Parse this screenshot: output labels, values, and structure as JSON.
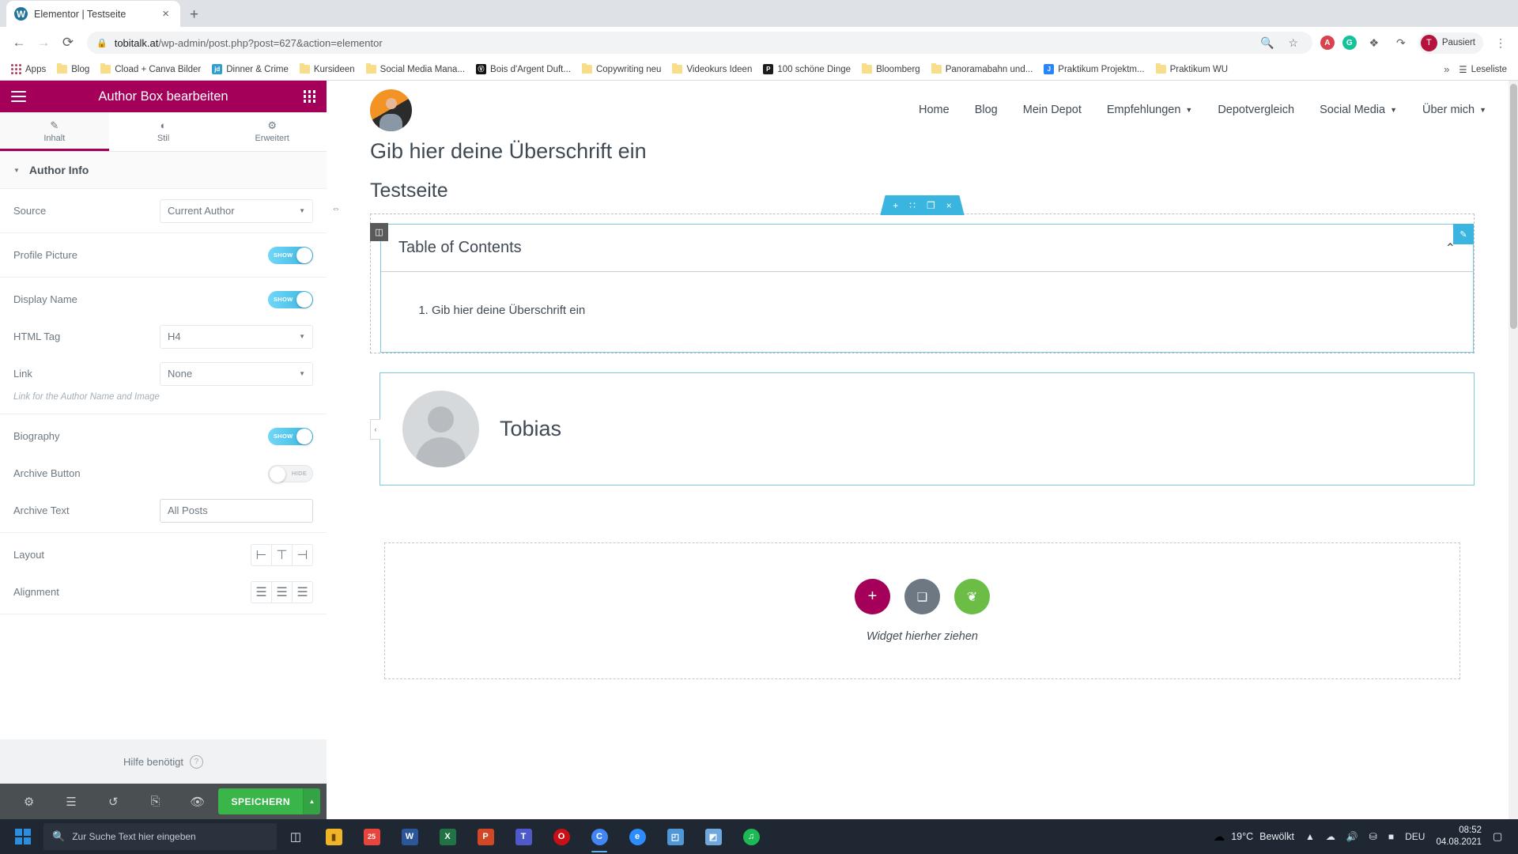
{
  "browser": {
    "tab": {
      "title": "Elementor | Testseite",
      "favicon": "wordpress-icon",
      "close": "×"
    },
    "new_tab": "+",
    "nav": {
      "back": "←",
      "forward": "→",
      "reload": "⟳"
    },
    "omnibox": {
      "lock_icon": "lock-icon",
      "url_host": "tobitalk.at",
      "url_path": "/wp-admin/post.php?post=627&action=elementor",
      "zoom_icon": "search-zoom-icon",
      "star_icon": "star-icon"
    },
    "extensions": [
      {
        "name": "adblock-extension",
        "glyph": "A",
        "color": "#d9434e"
      },
      {
        "name": "grammarly-extension",
        "glyph": "G",
        "color": "#15c39a"
      },
      {
        "name": "puzzle-extension",
        "glyph": "❖",
        "color": "#5f6368"
      },
      {
        "name": "lastpass-extension",
        "glyph": "↷",
        "color": "#5f6368"
      }
    ],
    "profile": {
      "avatar": "T",
      "label": "Pausiert"
    },
    "menu_icon": "⋮",
    "bookmarks": [
      {
        "label": "Apps",
        "icon": "apps-grid-icon"
      },
      {
        "label": "Blog",
        "icon": "folder-icon"
      },
      {
        "label": "Cload + Canva Bilder",
        "icon": "folder-icon"
      },
      {
        "label": "Dinner & Crime",
        "icon": "site-icon",
        "glyph": "jd",
        "color": "#2f9fd0"
      },
      {
        "label": "Kursideen",
        "icon": "folder-icon"
      },
      {
        "label": "Social Media Mana...",
        "icon": "folder-icon"
      },
      {
        "label": "Bois d'Argent Duft...",
        "icon": "site-icon",
        "glyph": "Ⓑ",
        "color": "#111111"
      },
      {
        "label": "Copywriting neu",
        "icon": "folder-icon"
      },
      {
        "label": "Videokurs Ideen",
        "icon": "folder-icon"
      },
      {
        "label": "100 schöne Dinge",
        "icon": "site-icon",
        "glyph": "P",
        "color": "#1c1c1c"
      },
      {
        "label": "Bloomberg",
        "icon": "folder-icon"
      },
      {
        "label": "Panoramabahn und...",
        "icon": "folder-icon"
      },
      {
        "label": "Praktikum Projektm...",
        "icon": "site-icon",
        "glyph": "J",
        "color": "#2684ff"
      },
      {
        "label": "Praktikum WU",
        "icon": "folder-icon"
      }
    ],
    "bookmarks_overflow": "»",
    "reading_list": {
      "label": "Leseliste",
      "icon": "reading-list-icon"
    }
  },
  "panel": {
    "header": {
      "title": "Author Box bearbeiten",
      "menu_icon": "hamburger-icon",
      "widgets_icon": "widgets-grid-icon"
    },
    "tabs": [
      {
        "label": "Inhalt",
        "icon": "pencil-icon",
        "active": true
      },
      {
        "label": "Stil",
        "icon": "contrast-icon",
        "active": false
      },
      {
        "label": "Erweitert",
        "icon": "gear-icon",
        "active": false
      }
    ],
    "section": {
      "title": "Author Info",
      "caret": "▼"
    },
    "controls": {
      "source": {
        "label": "Source",
        "value": "Current Author",
        "type": "select"
      },
      "profile_picture": {
        "label": "Profile Picture",
        "value": "SHOW",
        "type": "switch",
        "state": "on"
      },
      "display_name": {
        "label": "Display Name",
        "value": "SHOW",
        "type": "switch",
        "state": "on"
      },
      "html_tag": {
        "label": "HTML Tag",
        "value": "H4",
        "type": "select"
      },
      "link": {
        "label": "Link",
        "value": "None",
        "type": "select",
        "description": "Link for the Author Name and Image"
      },
      "biography": {
        "label": "Biography",
        "value": "SHOW",
        "type": "switch",
        "state": "on"
      },
      "archive_button": {
        "label": "Archive Button",
        "value": "HIDE",
        "type": "switch",
        "state": "off"
      },
      "archive_text": {
        "label": "Archive Text",
        "value": "All Posts",
        "type": "text"
      },
      "layout": {
        "label": "Layout",
        "options": [
          "layout-left-icon",
          "layout-top-icon",
          "layout-right-icon"
        ],
        "selected": 0
      },
      "alignment": {
        "label": "Alignment",
        "options": [
          "align-left-icon",
          "align-center-icon",
          "align-right-icon"
        ],
        "selected": 0
      }
    },
    "help": {
      "label": "Hilfe benötigt",
      "icon": "question-icon"
    },
    "footer": {
      "icons": [
        "settings-gear-icon",
        "navigator-layers-icon",
        "history-revisions-icon",
        "responsive-mode-icon",
        "preview-eye-icon"
      ],
      "save_label": "SPEICHERN",
      "save_caret": "▲",
      "save_color": "#39b54a"
    },
    "resizer_icon": "⇔",
    "accent_color": "#a4005a"
  },
  "canvas": {
    "site_nav": {
      "avatar": "site-avatar",
      "links": [
        {
          "label": "Home",
          "has_dropdown": false
        },
        {
          "label": "Blog",
          "has_dropdown": false
        },
        {
          "label": "Mein Depot",
          "has_dropdown": false
        },
        {
          "label": "Empfehlungen",
          "has_dropdown": true
        },
        {
          "label": "Depotvergleich",
          "has_dropdown": false
        },
        {
          "label": "Social Media",
          "has_dropdown": true
        },
        {
          "label": "Über mich",
          "has_dropdown": true
        }
      ],
      "caret": "▾"
    },
    "heading_main": "Gib hier deine Überschrift ein",
    "heading_sub": "Testseite",
    "element_toolbar": {
      "add": "+",
      "drag": "∷",
      "duplicate": "❐",
      "delete": "×",
      "color": "#39b5e0"
    },
    "column_handle": "◫",
    "toc": {
      "title": "Table of Contents",
      "collapse_icon": "⌃",
      "edit_icon": "✎",
      "items": [
        "Gib hier deine Überschrift ein"
      ]
    },
    "author_box": {
      "name": "Tobias",
      "avatar": "default-author-avatar",
      "left_tab": "‹"
    },
    "dropzone": {
      "text": "Widget hierher ziehen",
      "buttons": [
        {
          "name": "add-section-button",
          "glyph": "+",
          "color": "#a4005a"
        },
        {
          "name": "template-folder-button",
          "glyph": "❑",
          "color": "#6d7882"
        },
        {
          "name": "add-block-button",
          "glyph": "❦",
          "color": "#6bbd45"
        }
      ]
    }
  },
  "taskbar": {
    "start_icon": "windows-logo-icon",
    "search": {
      "placeholder": "Zur Suche Text hier eingeben",
      "icon": "search-icon"
    },
    "task_view_icon": "task-view-icon",
    "apps": [
      {
        "name": "file-explorer",
        "glyph": "🗀",
        "color": "#f0b429",
        "running": false
      },
      {
        "name": "calendar-app",
        "glyph": "25",
        "color": "#e8453c",
        "running": false
      },
      {
        "name": "word-app",
        "glyph": "W",
        "color": "#2b579a",
        "running": false
      },
      {
        "name": "excel-app",
        "glyph": "X",
        "color": "#217346",
        "running": false
      },
      {
        "name": "powerpoint-app",
        "glyph": "P",
        "color": "#d24726",
        "running": false
      },
      {
        "name": "teams-app",
        "glyph": "T",
        "color": "#5059c9",
        "running": false
      },
      {
        "name": "opera-app",
        "glyph": "O",
        "color": "#cc0f16",
        "running": false
      },
      {
        "name": "chrome-app",
        "glyph": "C",
        "color": "#4285f4",
        "running": true
      },
      {
        "name": "edge-app",
        "glyph": "e",
        "color": "#2d8cff",
        "running": false
      },
      {
        "name": "photos-app",
        "glyph": "◰",
        "color": "#4f97d6",
        "running": false
      },
      {
        "name": "paint-app",
        "glyph": "◩",
        "color": "#6fa8dc",
        "running": false
      },
      {
        "name": "spotify-app",
        "glyph": "♫",
        "color": "#1db954",
        "running": false
      }
    ],
    "weather": {
      "icon": "cloud-icon",
      "temp": "19°C",
      "condition": "Bewölkt"
    },
    "tray": [
      "chevron-up-icon",
      "onedrive-icon",
      "volume-icon",
      "network-icon",
      "battery-icon"
    ],
    "language": "DEU",
    "clock": {
      "time": "08:52",
      "date": "04.08.2021"
    },
    "notification_icon": "▢"
  }
}
